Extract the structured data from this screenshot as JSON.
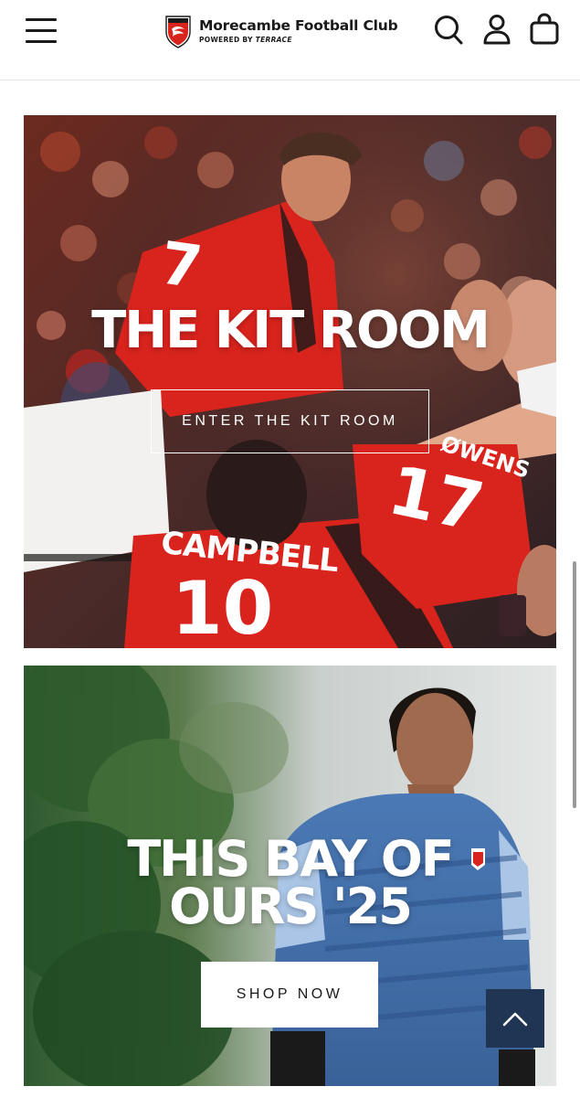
{
  "header": {
    "brand_name": "Morecambe Football Club",
    "brand_sub_prefix": "POWERED BY ",
    "brand_sub_partner": "TERRACE",
    "icons": [
      "menu-icon",
      "search-icon",
      "account-icon",
      "cart-icon"
    ]
  },
  "banners": [
    {
      "title": "THE KIT ROOM",
      "cta_label": "ENTER THE KIT ROOM",
      "shirt_names": [
        "CAMPBELL",
        "ØWENS"
      ],
      "shirt_numbers": [
        "10",
        "17",
        "7"
      ]
    },
    {
      "title": "THIS BAY OF OURS '25",
      "cta_label": "SHOP NOW"
    }
  ],
  "back_to_top": {
    "icon": "chevron-up-icon"
  },
  "colors": {
    "brand_red": "#d9231d",
    "navy": "#1f3553",
    "text_dark": "#1a1a1a"
  }
}
